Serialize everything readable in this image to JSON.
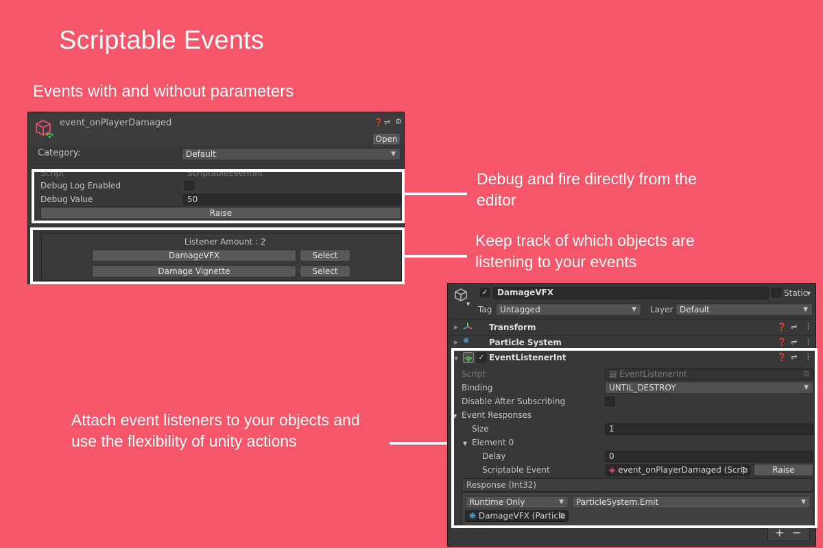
{
  "page": {
    "title": "Scriptable Events",
    "subtitle": "Events with and without parameters",
    "captions": {
      "debug": "Debug  and fire directly from the editor",
      "listeners": "Keep track of which objects are listening to your events",
      "attach": "Attach event listeners to your objects and use the flexibility of unity actions"
    }
  },
  "colors": {
    "background": "#f5566a",
    "panel": "#383838",
    "field": "#2a2a2a",
    "highlight": "#ffffff"
  },
  "event_panel": {
    "name": "event_onPlayerDamaged",
    "open_label": "Open",
    "category_label": "Category:",
    "category_value": "Default",
    "script_label": "Script",
    "script_value": "ScriptableEventInt",
    "debug_log_label": "Debug Log Enabled",
    "debug_value_label": "Debug Value",
    "debug_value": "50",
    "raise_label": "Raise",
    "listener_amount": "Listener Amount : 2",
    "listeners": [
      {
        "name": "DamageVFX",
        "select": "Select"
      },
      {
        "name": "Damage Vignette",
        "select": "Select"
      }
    ]
  },
  "inspector": {
    "object_name": "DamageVFX",
    "static_label": "Static",
    "tag_label": "Tag",
    "tag_value": "Untagged",
    "layer_label": "Layer",
    "layer_value": "Default",
    "components": {
      "transform": "Transform",
      "particle": "Particle System",
      "listener": "EventListenerInt"
    },
    "script_label": "Script",
    "script_value": "EventListenerInt",
    "binding_label": "Binding",
    "binding_value": "UNTIL_DESTROY",
    "disable_label": "Disable After Subscribing",
    "responses_label": "Event Responses",
    "size_label": "Size",
    "size_value": "1",
    "element_label": "Element 0",
    "delay_label": "Delay",
    "delay_value": "0",
    "scriptable_event_label": "Scriptable Event",
    "scriptable_event_value": "event_onPlayerDamaged (Scrip",
    "raise_label": "Raise",
    "response_header": "Response (Int32)",
    "runtime_value": "Runtime Only",
    "function_value": "ParticleSystem.Emit",
    "target_value": "DamageVFX (Particle",
    "plus": "+",
    "minus": "−"
  }
}
